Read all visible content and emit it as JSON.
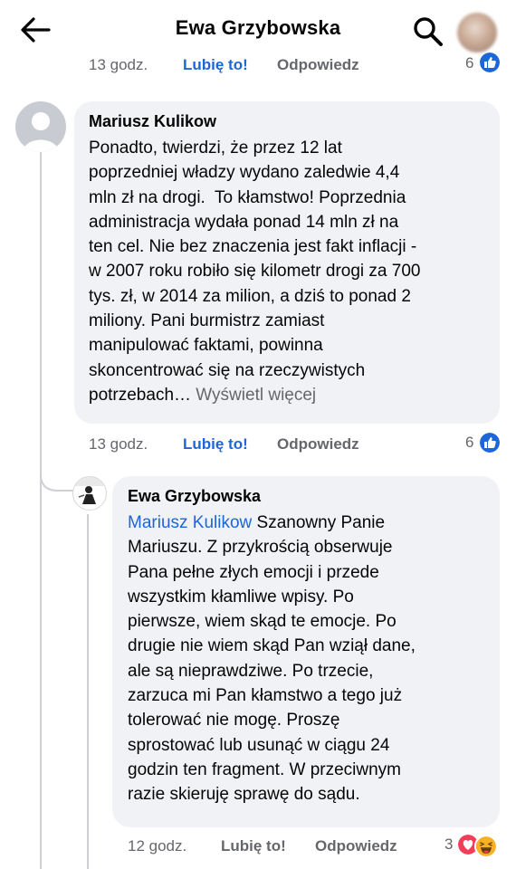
{
  "header": {
    "title": "Ewa Grzybowska"
  },
  "top_meta": {
    "time": "13 godz.",
    "like": "Lubię to!",
    "reply": "Odpowiedz",
    "reaction_count": "6"
  },
  "comment1": {
    "author": "Mariusz Kulikow",
    "lines": [
      "Ponadto, twierdzi, że przez 12 lat",
      "poprzedniej władzy wydano zaledwie 4,4",
      "mln zł na drogi.  To kłamstwo! Poprzednia",
      "administracja wydała ponad 14 mln zł na",
      "ten cel. Nie bez znaczenia jest fakt inflacji -",
      "w 2007 roku robiło się kilometr drogi za 700",
      "tys. zł, w 2014 za milion, a dziś to ponad 2",
      "miliony. Pani burmistrz zamiast",
      "manipulować faktami, powinna",
      "skoncentrować się na rzeczywistych"
    ],
    "last_line": "potrzebach…",
    "see_more": " Wyświetl więcej",
    "time": "13 godz.",
    "like": "Lubię to!",
    "reply": "Odpowiedz",
    "reaction_count": "6"
  },
  "comment2": {
    "author": "Ewa Grzybowska",
    "mention": "Mariusz Kulikow",
    "first_line_rest": " Szanowny Panie",
    "lines": [
      "Mariuszu. Z przykrością obserwuje",
      "Pana pełne złych emocji i przede",
      "wszystkim kłamliwe wpisy. Po",
      "pierwsze, wiem skąd te emocje. Po",
      "drugie nie wiem skąd Pan wziął dane,",
      "ale są nieprawdziwe. Po trzecie,",
      "zarzuca mi Pan kłamstwo a tego już",
      "tolerować nie mogę. Proszę",
      "sprostować lub usunąć w ciągu 24",
      "godzin ten fragment. W przeciwnym",
      "razie skieruję sprawę do sądu."
    ],
    "time": "12 godz.",
    "like": "Lubię to!",
    "reply": "Odpowiedz",
    "reaction_count": "3"
  },
  "colors": {
    "like_blue": "#1b66d9",
    "meta_gray": "#65676b",
    "bubble_bg": "#f0f2f5",
    "love_red": "#f33e58",
    "haha_yellow": "#f7b125"
  }
}
